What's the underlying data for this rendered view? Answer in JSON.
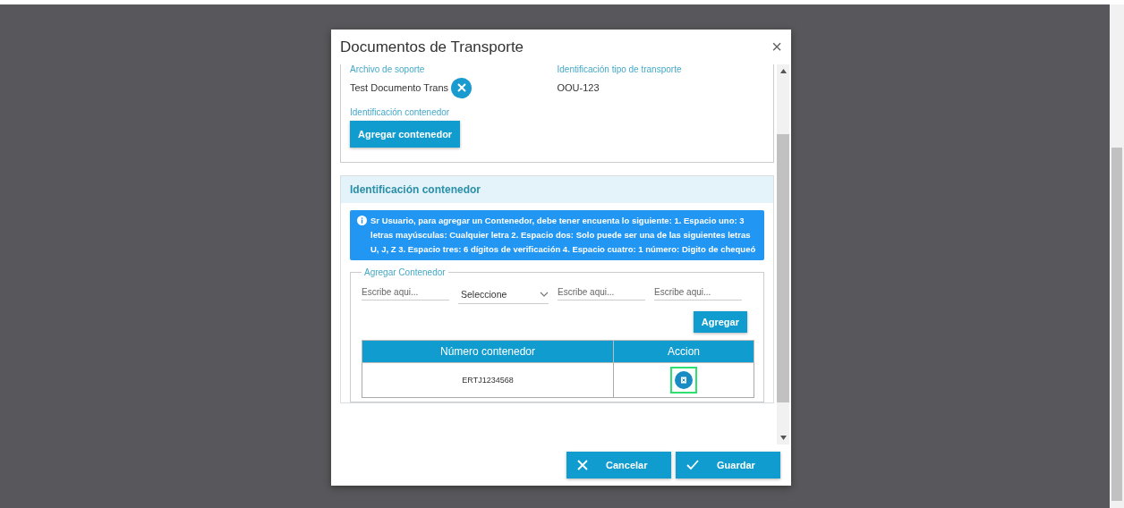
{
  "dialog": {
    "title": "Documentos de Transporte",
    "close": "×"
  },
  "top_section": {
    "fields": [
      {
        "label": "Archivo de soporte",
        "value": "Test Documento Trans",
        "removable": true
      },
      {
        "label": "Identificación tipo de transporte",
        "value": "OOU-123",
        "removable": false
      }
    ],
    "container_label": "Identificación contenedor",
    "add_button": "Agregar contenedor"
  },
  "container_panel": {
    "title": "Identificación contenedor",
    "info": "Sr Usuario, para agregar un Contenedor, debe tener encuenta lo siguiente: 1. Espacio uno: 3 letras mayúsculas: Cualquier letra 2. Espacio dos: Solo puede ser una de las siguientes letras U, J, Z 3. Espacio tres: 6 dígitos de verificación 4. Espacio cuatro: 1 número: Digito de chequeó",
    "fieldset": {
      "legend": "Agregar Contenedor",
      "inputs": [
        {
          "kind": "text",
          "placeholder": "Escribe aqui..."
        },
        {
          "kind": "select",
          "value": "Seleccione"
        },
        {
          "kind": "text",
          "placeholder": "Escribe aqui..."
        },
        {
          "kind": "text",
          "placeholder": "Escribe aqui..."
        }
      ],
      "add_button": "Agregar"
    },
    "table": {
      "columns": [
        "Número contenedor",
        "Accion"
      ],
      "rows": [
        {
          "number": "ERTJ1234568",
          "highlighted": true
        }
      ]
    }
  },
  "footer": {
    "buttons": [
      {
        "kind": "cancel",
        "label": "Cancelar"
      },
      {
        "kind": "save",
        "label": "Guardar"
      }
    ]
  }
}
